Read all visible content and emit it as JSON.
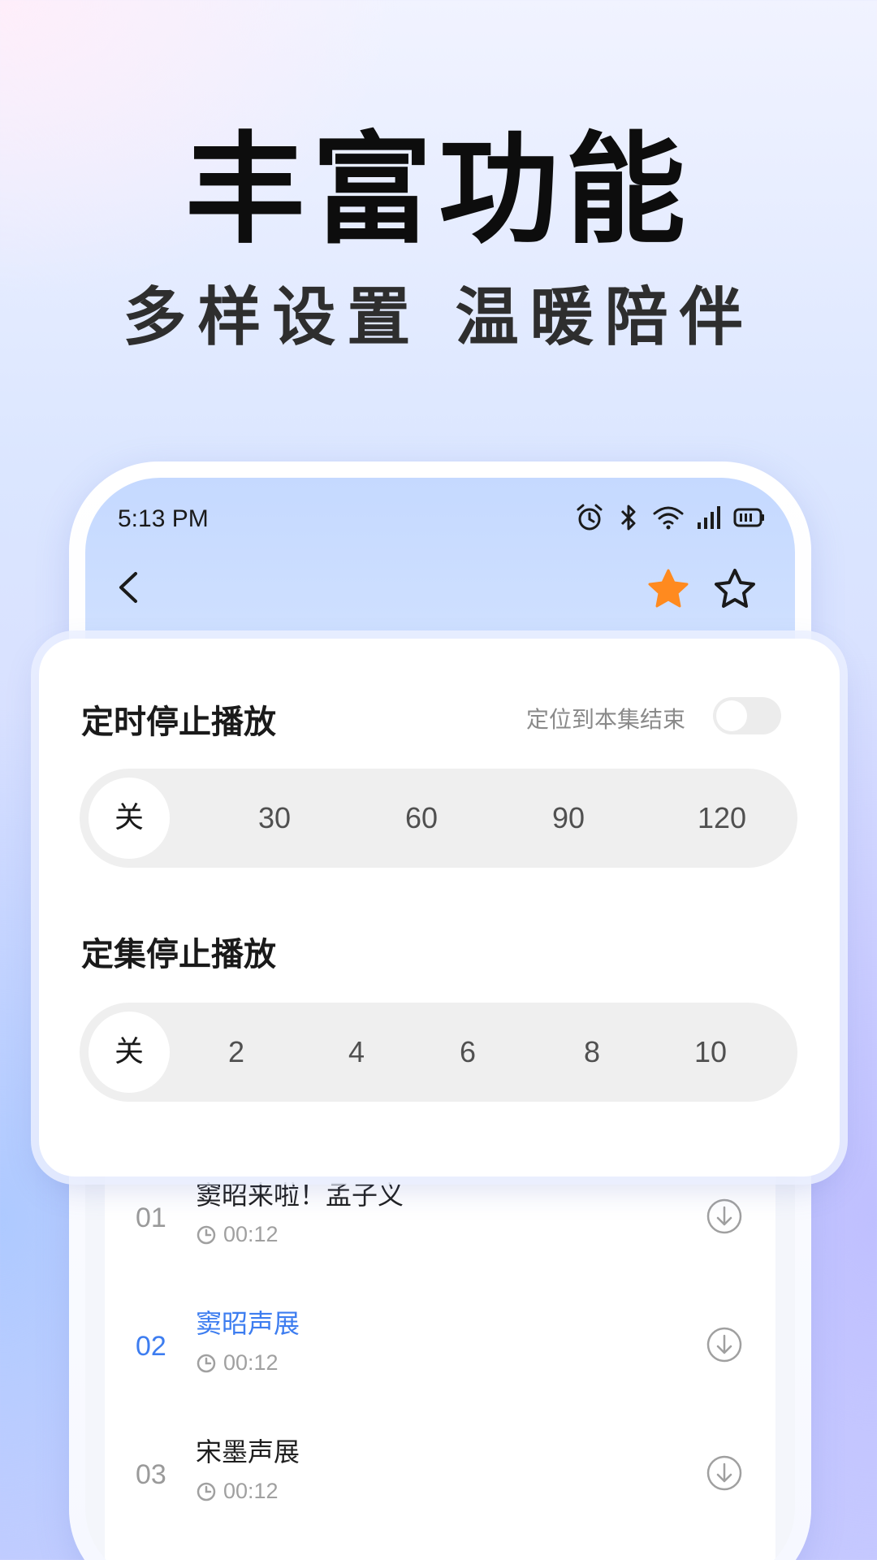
{
  "hero": {
    "title": "丰富功能",
    "subtitle": "多样设置 温暖陪伴"
  },
  "status_bar": {
    "time": "5:13 PM",
    "icons": [
      "alarm-icon",
      "bluetooth-icon",
      "wifi-icon",
      "signal-icon",
      "battery-icon"
    ]
  },
  "header": {
    "back_icon": "chevron-left-icon",
    "favorite_icon": "star-filled-icon",
    "star_icon": "star-outline-icon",
    "favorite_color": "#FF8A1F"
  },
  "timer_section": {
    "title": "定时停止播放",
    "toggle_label": "定位到本集结束",
    "toggle_on": false,
    "options": [
      "关",
      "30",
      "60",
      "90",
      "120"
    ],
    "selected": "关"
  },
  "episode_section": {
    "title": "定集停止播放",
    "options": [
      "关",
      "2",
      "4",
      "6",
      "8",
      "10"
    ],
    "selected": "关"
  },
  "episodes": [
    {
      "num": "01",
      "title": "窦昭来啦！孟子义",
      "duration": "00:12",
      "active": false
    },
    {
      "num": "02",
      "title": "窦昭声展",
      "duration": "00:12",
      "active": true
    },
    {
      "num": "03",
      "title": "宋墨声展",
      "duration": "00:12",
      "active": false
    }
  ],
  "colors": {
    "accent": "#3D7DF0",
    "header_bg": "#C5D9FF"
  }
}
